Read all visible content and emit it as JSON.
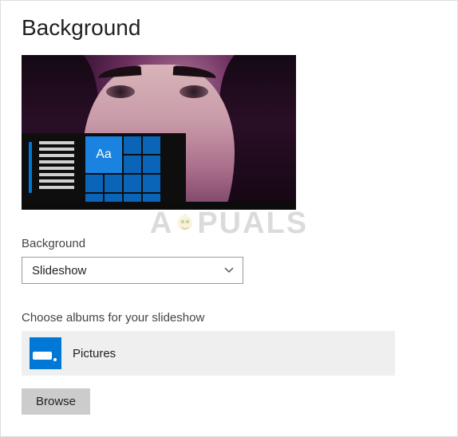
{
  "page": {
    "title": "Background"
  },
  "preview": {
    "tile_text": "Aa"
  },
  "background_section": {
    "label": "Background",
    "selected": "Slideshow"
  },
  "albums_section": {
    "label": "Choose albums for your slideshow",
    "album_name": "Pictures",
    "browse_label": "Browse"
  },
  "watermark": {
    "text_left": "A",
    "text_right": "PUALS"
  }
}
